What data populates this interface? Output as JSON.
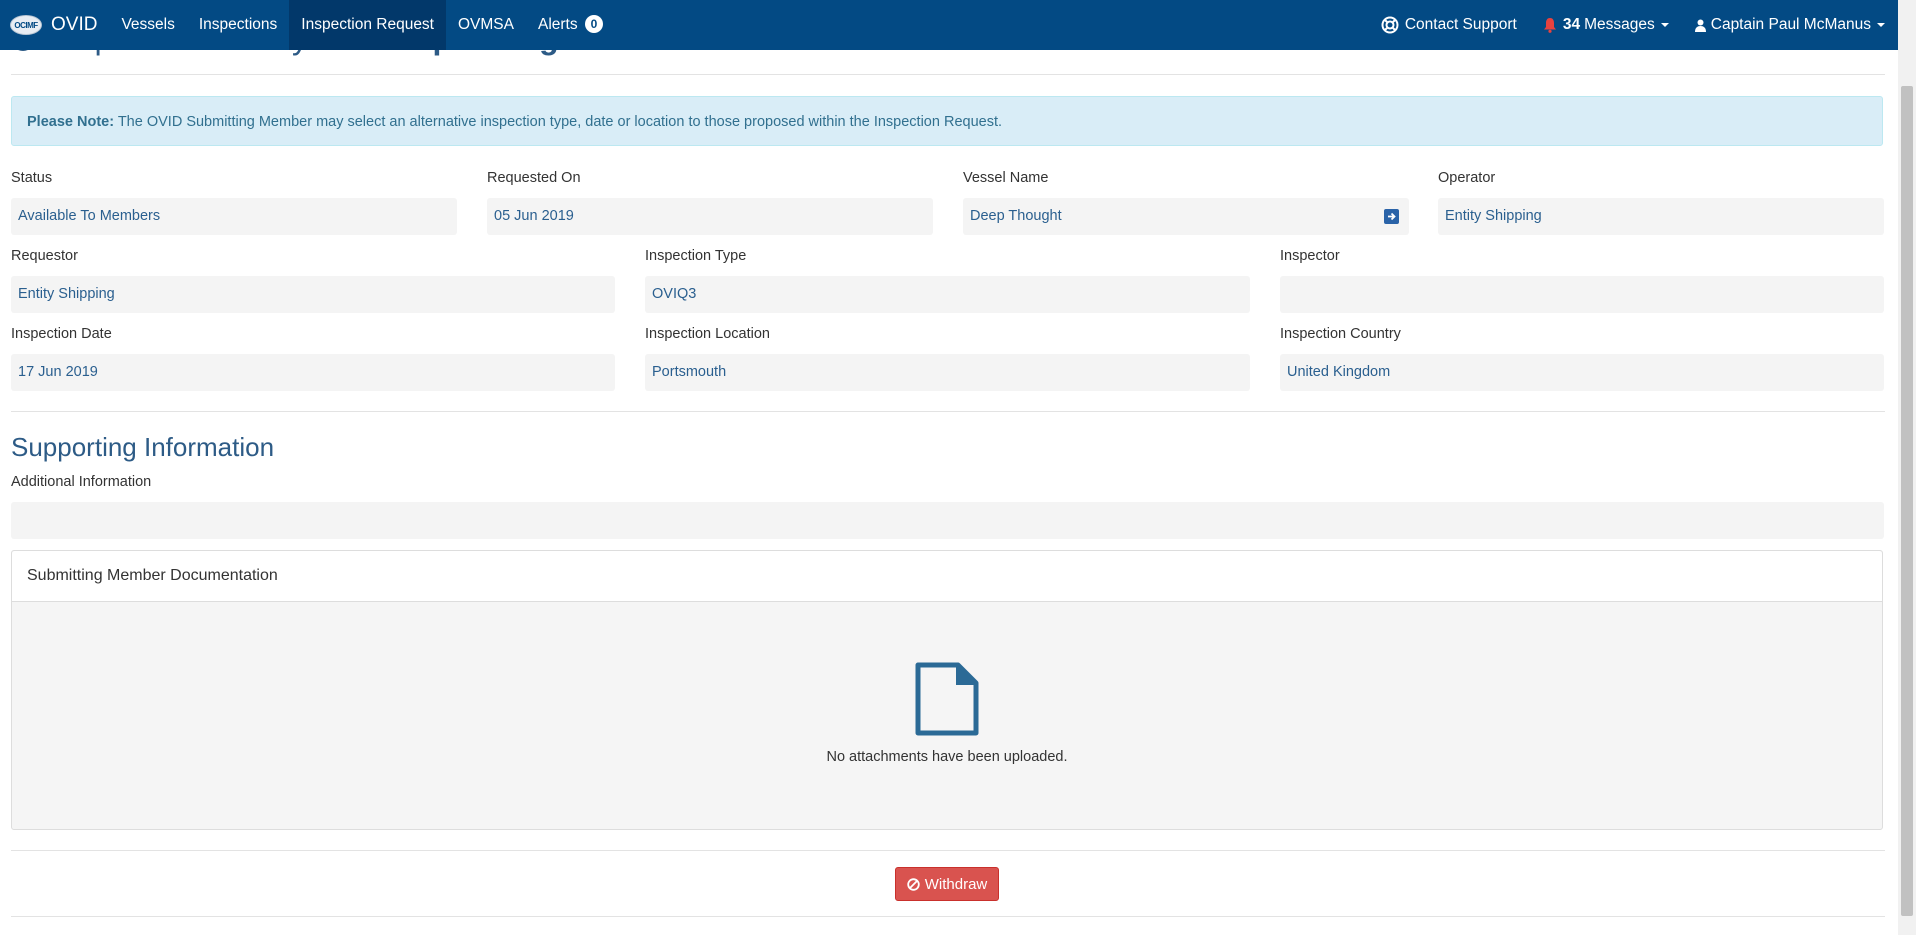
{
  "nav": {
    "logo_text": "OCIMF",
    "brand": "OVID",
    "items": [
      {
        "label": "Vessels"
      },
      {
        "label": "Inspections"
      },
      {
        "label": "Inspection Request"
      },
      {
        "label": "OVMSA"
      },
      {
        "label": "Alerts"
      }
    ],
    "active_item": "Inspection Request",
    "alerts_count": "0",
    "contact_support": "Contact Support",
    "messages_count": "34",
    "messages_label": "Messages",
    "user_name": "Captain Paul McManus"
  },
  "page": {
    "heading_prefix": "Request Summary For",
    "heading_vessel": "Deep Thought"
  },
  "note": {
    "label": "Please Note:",
    "text": "The OVID Submitting Member may select an alternative inspection type, date or location to those proposed within the Inspection Request."
  },
  "fields": {
    "status": {
      "label": "Status",
      "value": "Available To Members"
    },
    "requested_on": {
      "label": "Requested On",
      "value": "05 Jun 2019"
    },
    "vessel_name": {
      "label": "Vessel Name",
      "value": "Deep Thought"
    },
    "operator": {
      "label": "Operator",
      "value": "Entity Shipping"
    },
    "requestor": {
      "label": "Requestor",
      "value": "Entity Shipping"
    },
    "inspection_type": {
      "label": "Inspection Type",
      "value": "OVIQ3"
    },
    "inspector": {
      "label": "Inspector",
      "value": ""
    },
    "inspection_date": {
      "label": "Inspection Date",
      "value": "17 Jun 2019"
    },
    "inspection_location": {
      "label": "Inspection Location",
      "value": "Portsmouth"
    },
    "inspection_country": {
      "label": "Inspection Country",
      "value": "United Kingdom"
    }
  },
  "supporting": {
    "title": "Supporting Information",
    "additional_label": "Additional Information",
    "additional_value": ""
  },
  "documentation": {
    "title": "Submitting Member Documentation",
    "empty_text": "No attachments have been uploaded."
  },
  "actions": {
    "withdraw_label": "Withdraw"
  },
  "colors": {
    "navbar": "#034a84",
    "accent_text": "#2a5f8f",
    "danger": "#d9534f",
    "info_bg": "#d9edf7"
  }
}
